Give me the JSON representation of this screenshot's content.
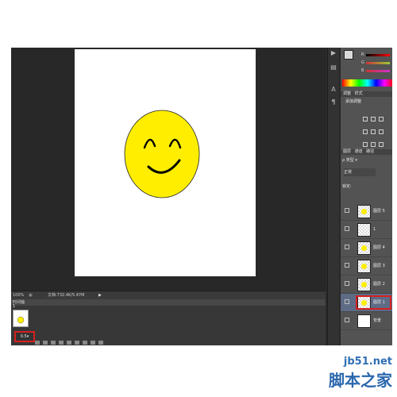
{
  "status_bar": {
    "zoom": "100%",
    "doc_info": "文档:732.4K/5.47M"
  },
  "timeline": {
    "tab_label": "时间轴",
    "frame_number": "1",
    "frame_delay": "0.5▾"
  },
  "color_panel": {
    "labels": [
      "R",
      "G",
      "B"
    ]
  },
  "adjustments_panel": {
    "tabs": [
      "调整",
      "样式"
    ],
    "title": "添加调整"
  },
  "layers_panel": {
    "tabs": [
      "图层",
      "通道",
      "路径"
    ],
    "filter_label": "ρ 类型 ▾",
    "blend_mode": "正常",
    "lock_label": "锁定:",
    "layers": [
      {
        "name": "图层 5",
        "thumb": "dot"
      },
      {
        "name": "1",
        "thumb": "plain"
      },
      {
        "name": "图层 4",
        "thumb": "dot"
      },
      {
        "name": "图层 3",
        "thumb": "dot"
      },
      {
        "name": "图层 2",
        "thumb": "dot"
      },
      {
        "name": "图层 1",
        "thumb": "dot",
        "selected": true
      },
      {
        "name": "背景",
        "thumb": "white"
      }
    ]
  },
  "canvas": {
    "face_color": "#ffee00",
    "outline_color": "#000000"
  },
  "watermark": {
    "line1": "jb51.net",
    "line2": "脚本之家"
  }
}
